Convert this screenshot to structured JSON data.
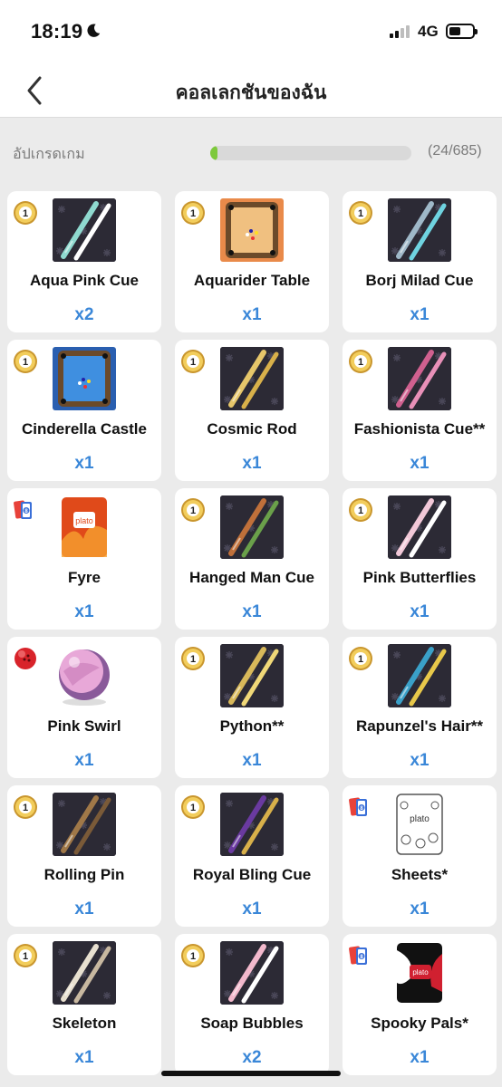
{
  "status_bar": {
    "time": "18:19",
    "network": "4G"
  },
  "header": {
    "title": "คอลเลกชันของฉัน"
  },
  "progress": {
    "label": "อัปเกรดเกม",
    "count": "(24/685)",
    "fraction": 0.035
  },
  "items": [
    {
      "name": "Aqua Pink Cue",
      "qty": "x2",
      "badge": "coin",
      "art": "cue",
      "colors": [
        "#8fd9cf",
        "#ffffff"
      ]
    },
    {
      "name": "Aquarider Table",
      "qty": "x1",
      "badge": "coin",
      "art": "table",
      "colors": [
        "#f0c080",
        "#e98a4a"
      ]
    },
    {
      "name": "Borj Milad Cue",
      "qty": "x1",
      "badge": "coin",
      "art": "cue",
      "colors": [
        "#9fb8c8",
        "#6fd3e0"
      ]
    },
    {
      "name": "Cinderella Castle",
      "qty": "x1",
      "badge": "coin",
      "art": "table",
      "colors": [
        "#3f8fe0",
        "#2a5fb0"
      ]
    },
    {
      "name": "Cosmic Rod",
      "qty": "x1",
      "badge": "coin",
      "art": "cue",
      "colors": [
        "#e6c66a",
        "#d8b04a"
      ]
    },
    {
      "name": "Fashionista Cue**",
      "qty": "x1",
      "badge": "coin",
      "art": "cue",
      "colors": [
        "#d0608f",
        "#e890b8"
      ]
    },
    {
      "name": "Fyre",
      "qty": "x1",
      "badge": "cards",
      "art": "card-fire",
      "colors": [
        "#e04a1a",
        "#f6a030"
      ]
    },
    {
      "name": "Hanged Man Cue",
      "qty": "x1",
      "badge": "coin",
      "art": "cue",
      "colors": [
        "#c0703a",
        "#6aa04a"
      ]
    },
    {
      "name": "Pink Butterflies",
      "qty": "x1",
      "badge": "coin",
      "art": "cue",
      "colors": [
        "#f2c8d8",
        "#ffffff"
      ]
    },
    {
      "name": "Pink Swirl",
      "qty": "x1",
      "badge": "ball",
      "art": "ball",
      "colors": [
        "#e8a8d8",
        "#8a5a9a"
      ]
    },
    {
      "name": "Python**",
      "qty": "x1",
      "badge": "coin",
      "art": "cue",
      "colors": [
        "#d8b85a",
        "#f0d878"
      ]
    },
    {
      "name": "Rapunzel's Hair**",
      "qty": "x1",
      "badge": "coin",
      "art": "cue",
      "colors": [
        "#3aa0c8",
        "#e8c84a"
      ]
    },
    {
      "name": "Rolling Pin",
      "qty": "x1",
      "badge": "coin",
      "art": "cue",
      "colors": [
        "#a07848",
        "#7a5a38"
      ]
    },
    {
      "name": "Royal Bling Cue",
      "qty": "x1",
      "badge": "coin",
      "art": "cue",
      "colors": [
        "#6a3aa0",
        "#d8b04a"
      ]
    },
    {
      "name": "Sheets*",
      "qty": "x1",
      "badge": "cards",
      "art": "card-sheets",
      "colors": [
        "#ffffff",
        "#555555"
      ]
    },
    {
      "name": "Skeleton",
      "qty": "x1",
      "badge": "coin",
      "art": "cue",
      "colors": [
        "#e8e0d0",
        "#c8b8a0"
      ]
    },
    {
      "name": "Soap Bubbles",
      "qty": "x2",
      "badge": "coin",
      "art": "cue",
      "colors": [
        "#f2b8cc",
        "#ffffff"
      ]
    },
    {
      "name": "Spooky Pals*",
      "qty": "x1",
      "badge": "cards",
      "art": "card-spooky",
      "colors": [
        "#d02030",
        "#111111"
      ]
    }
  ],
  "icons": {
    "back": "chevron-left-icon",
    "moon": "moon-icon",
    "signal": "signal-icon",
    "battery": "battery-icon",
    "coin": "gold-coin-icon",
    "cards": "card-pack-icon",
    "ball": "bowling-ball-icon"
  },
  "colors": {
    "accent": "#3a87d8",
    "progress": "#7dc93b",
    "background": "#ebebeb"
  }
}
